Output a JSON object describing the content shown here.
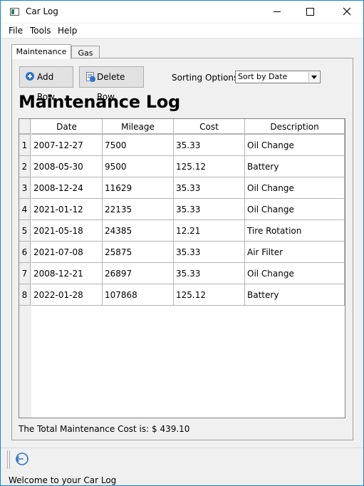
{
  "window": {
    "title": "Car Log"
  },
  "menu": [
    "File",
    "Tools",
    "Help"
  ],
  "tabs": [
    {
      "label": "Maintenance",
      "active": true
    },
    {
      "label": "Gas",
      "active": false
    }
  ],
  "toolbar": {
    "add_label": "Add Row",
    "delete_label": "Delete Row",
    "sort_label": "Sorting Options:",
    "sort_value": "Sort by Date"
  },
  "page_title": "Maintenance Log",
  "table": {
    "columns": [
      "Date",
      "Mileage",
      "Cost",
      "Description"
    ],
    "rows": [
      {
        "num": "1",
        "cells": [
          "2007-12-27",
          "7500",
          "35.33",
          "Oil Change"
        ]
      },
      {
        "num": "2",
        "cells": [
          "2008-05-30",
          "9500",
          "125.12",
          "Battery"
        ]
      },
      {
        "num": "3",
        "cells": [
          "2008-12-24",
          "11629",
          "35.33",
          "Oil Change"
        ]
      },
      {
        "num": "4",
        "cells": [
          "2021-01-12",
          "22135",
          "35.33",
          "Oil Change"
        ]
      },
      {
        "num": "5",
        "cells": [
          "2021-05-18",
          "24385",
          "12.21",
          "Tire Rotation"
        ]
      },
      {
        "num": "6",
        "cells": [
          "2021-07-08",
          "25875",
          "35.33",
          "Air Filter"
        ]
      },
      {
        "num": "7",
        "cells": [
          "2008-12-21",
          "26897",
          "35.33",
          "Oil Change"
        ]
      },
      {
        "num": "8",
        "cells": [
          "2022-01-28",
          "107868",
          "125.12",
          "Battery"
        ]
      }
    ]
  },
  "total_text": "The Total Maintenance Cost is: $  439.10",
  "status_text": "Welcome to your Car Log",
  "colors": {
    "accent": "#1883d7",
    "icon_blue": "#2a73c9"
  },
  "icons": {
    "app": "car-log-app-icon",
    "add": "plus-circle-icon",
    "delete": "delete-document-icon",
    "status": "back-arrow-icon"
  }
}
